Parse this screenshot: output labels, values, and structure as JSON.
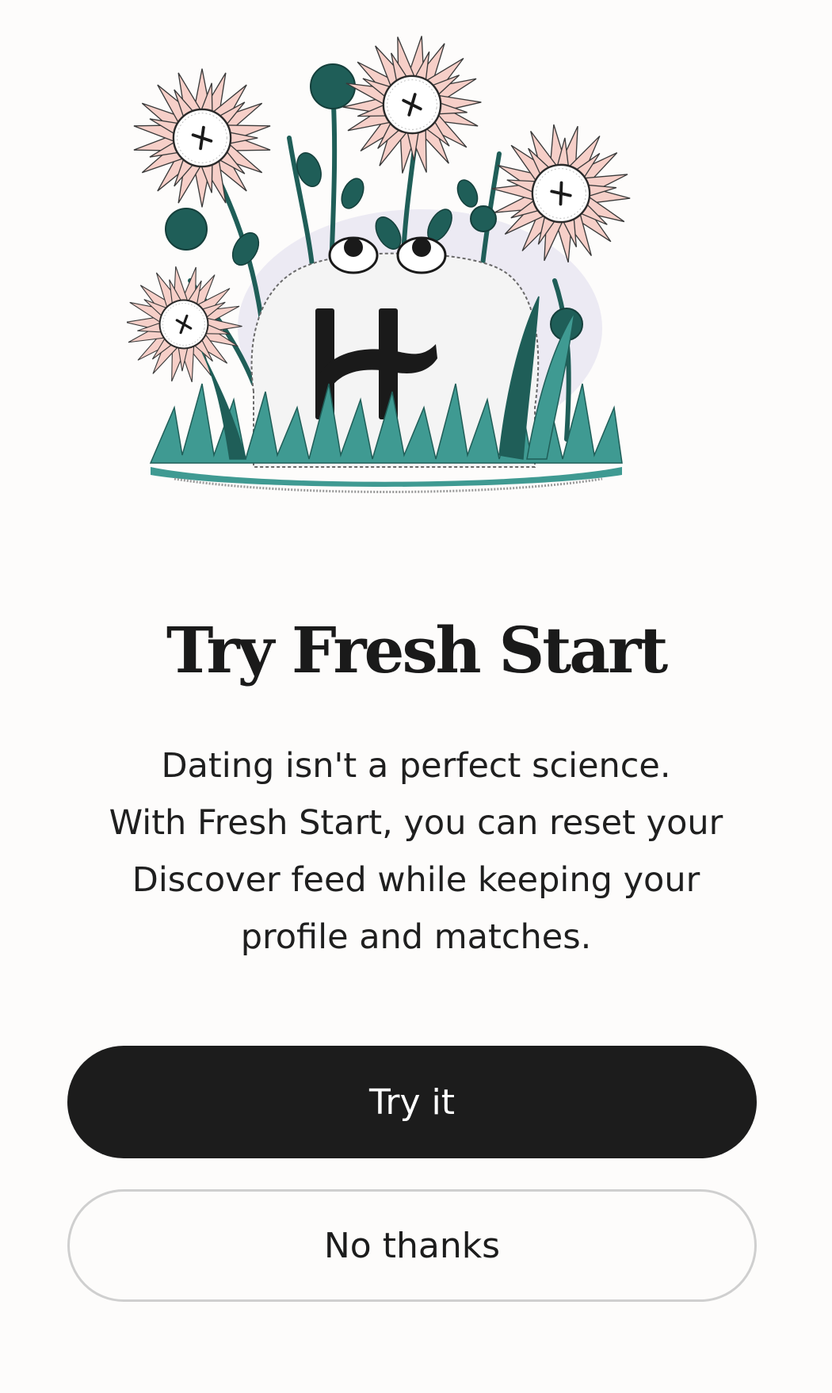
{
  "dialog": {
    "title": "Try Fresh Start",
    "body_lines": [
      "Dating isn't a perfect science.",
      "With Fresh Start, you can reset your",
      "Discover feed while keeping your",
      "profile and matches."
    ],
    "primary_label": "Try it",
    "secondary_label": "No thanks"
  },
  "illustration": {
    "logo_letter": "H",
    "colors": {
      "petal": "#f6cfc8",
      "teal_dark": "#1f5e58",
      "teal": "#3f9a92",
      "ink": "#1a1a1a"
    }
  },
  "colors": {
    "primary_button": "#1c1c1c",
    "secondary_border": "#cfcfcf",
    "background": "#fdfcfb"
  }
}
